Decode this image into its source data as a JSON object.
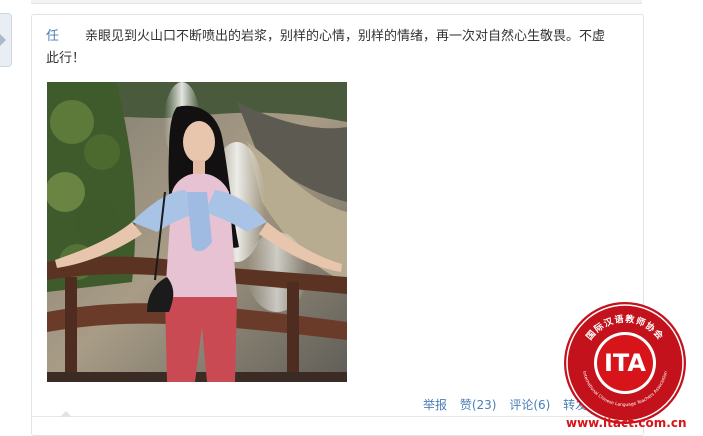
{
  "post": {
    "author": "任",
    "text": "亲眼见到火山口不断喷出的岩浆，别样的心情，别样的情绪，再一次对自然心生敬畏。不虚此行！"
  },
  "actions": {
    "report": "举报",
    "like": "赞(23)",
    "comment": "评论(6)",
    "forward": "转发"
  },
  "watermark": {
    "logo_text": "ITA",
    "ring_top_text": "国际汉语教师协会",
    "ring_bottom_text": "International Chinese Language Teachers Association",
    "url": "www.itact.com.cn",
    "color": "#d7141a"
  }
}
